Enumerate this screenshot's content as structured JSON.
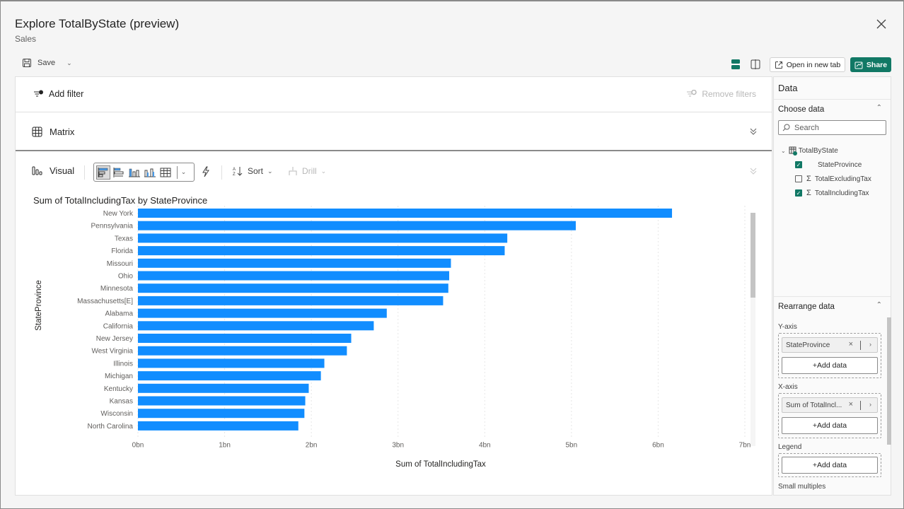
{
  "dialog": {
    "title": "Explore TotalByState (preview)",
    "subtitle": "Sales",
    "close_icon": "close-icon"
  },
  "toolbar": {
    "save_label": "Save",
    "open_new_tab_label": "Open in new tab",
    "share_label": "Share",
    "accent_color": "#117865"
  },
  "filters": {
    "add_filter_label": "Add filter",
    "remove_filters_label": "Remove filters"
  },
  "matrix": {
    "label": "Matrix"
  },
  "visual": {
    "label": "Visual",
    "chart_types": [
      "stacked-bar",
      "clustered-bar",
      "stacked-column",
      "clustered-column",
      "table"
    ],
    "active_chart_type": "stacked-bar",
    "sort_label": "Sort",
    "drill_label": "Drill"
  },
  "chart_data": {
    "type": "bar",
    "orientation": "horizontal",
    "title": "Sum of TotalIncludingTax by StateProvince",
    "xlabel": "Sum of TotalIncludingTax",
    "ylabel": "StateProvince",
    "bar_color": "#118DFF",
    "xlim": [
      0,
      7
    ],
    "x_unit": "bn",
    "x_ticks": [
      "0bn",
      "1bn",
      "2bn",
      "3bn",
      "4bn",
      "5bn",
      "6bn",
      "7bn"
    ],
    "grid": true,
    "categories": [
      "New York",
      "Pennsylvania",
      "Texas",
      "Florida",
      "Missouri",
      "Ohio",
      "Minnesota",
      "Massachusetts[E]",
      "Alabama",
      "California",
      "New Jersey",
      "West Virginia",
      "Illinois",
      "Michigan",
      "Kentucky",
      "Kansas",
      "Wisconsin",
      "North Carolina"
    ],
    "values": [
      6.16,
      5.05,
      4.26,
      4.23,
      3.61,
      3.59,
      3.58,
      3.52,
      2.87,
      2.72,
      2.46,
      2.41,
      2.15,
      2.11,
      1.97,
      1.93,
      1.92,
      1.85
    ]
  },
  "side_panel": {
    "title": "Data",
    "choose_data_label": "Choose data",
    "search_placeholder": "Search",
    "table_name": "TotalByState",
    "fields": [
      {
        "name": "StateProvince",
        "checked": true,
        "measure": false
      },
      {
        "name": "TotalExcludingTax",
        "checked": false,
        "measure": true
      },
      {
        "name": "TotalIncludingTax",
        "checked": true,
        "measure": true
      }
    ],
    "rearrange_label": "Rearrange data",
    "y_axis_label": "Y-axis",
    "y_axis_field": "StateProvince",
    "x_axis_label": "X-axis",
    "x_axis_field": "Sum of TotalIncl...",
    "legend_label": "Legend",
    "small_multiples_label": "Small multiples",
    "add_data_label": "+Add data"
  }
}
